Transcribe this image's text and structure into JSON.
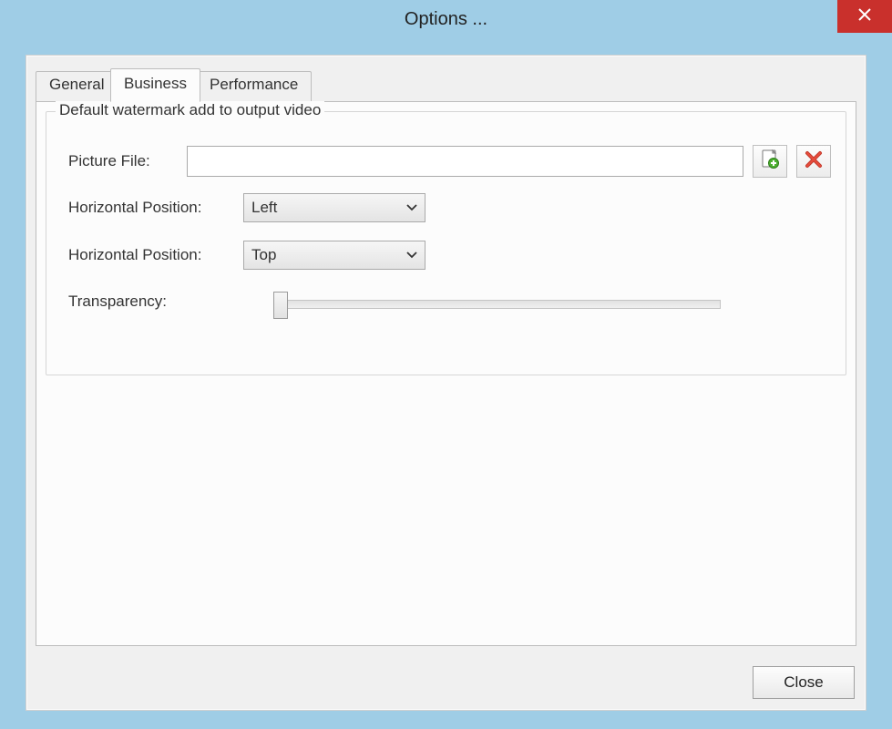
{
  "window": {
    "title": "Options ...",
    "close_icon": "×"
  },
  "tabs": {
    "general": "General",
    "business": "Business",
    "performance": "Performance",
    "active": "business"
  },
  "groupbox": {
    "title": "Default watermark add to output video"
  },
  "picture": {
    "label": "Picture File:",
    "value": "",
    "add_icon": "add-picture-icon",
    "delete_icon": "delete-picture-icon"
  },
  "hpos": {
    "label": "Horizontal Position:",
    "value": "Left"
  },
  "vpos": {
    "label": "Horizontal Position:",
    "value": "Top"
  },
  "transparency": {
    "label": "Transparency:",
    "value": 0
  },
  "footer": {
    "close_label": "Close"
  },
  "colors": {
    "frame": "#9fcde6",
    "close_btn": "#c9302c"
  }
}
